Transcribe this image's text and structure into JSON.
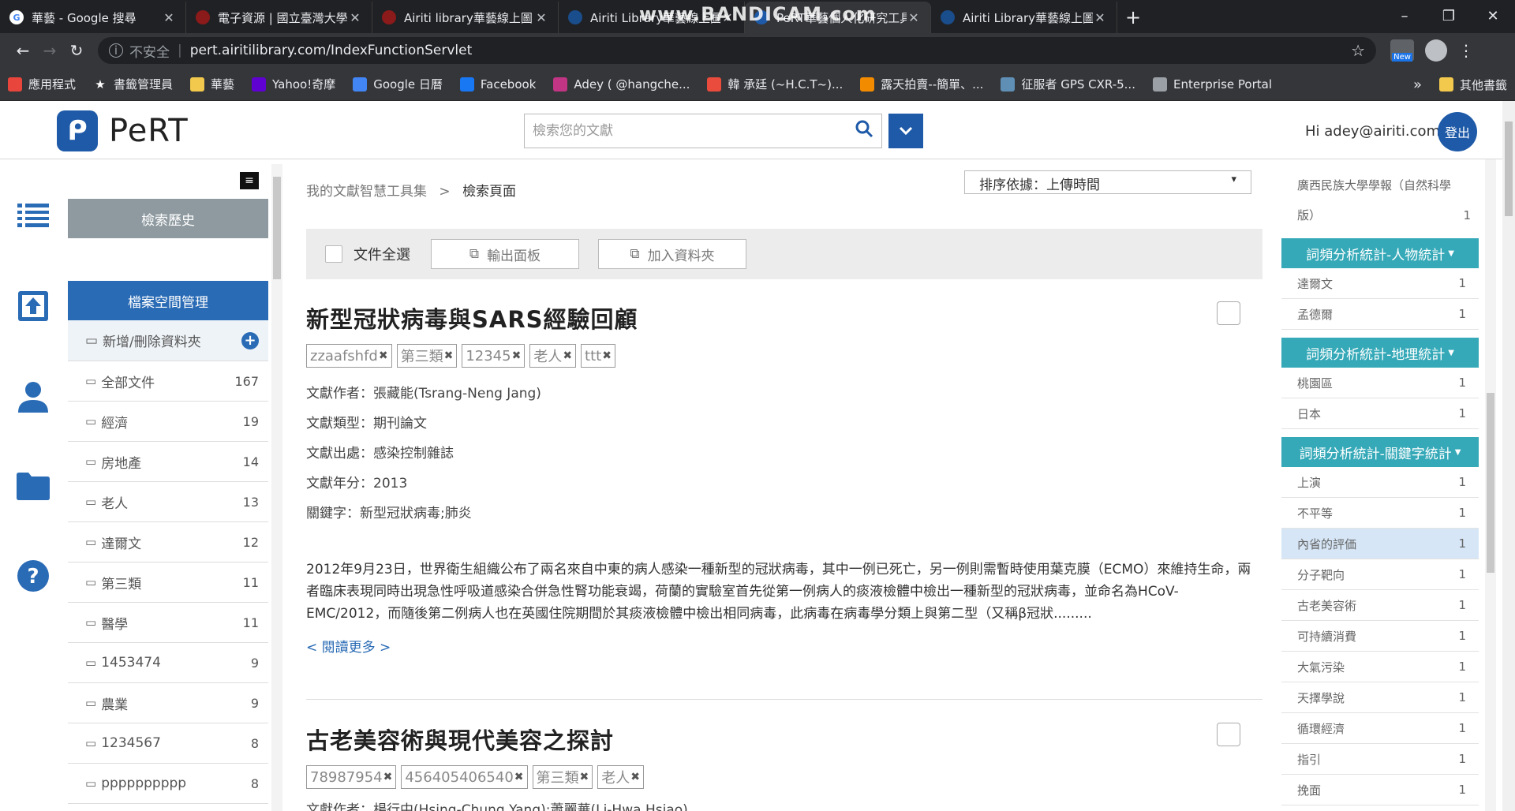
{
  "browser": {
    "watermark": "www.BANDICAM.com",
    "tabs": [
      {
        "title": "華藝 - Google 搜尋",
        "icon": "google-icon",
        "color": "#ffffff",
        "active": false
      },
      {
        "title": "電子資源 | 國立臺灣大學",
        "icon": "ntu-icon",
        "color": "#8b1a1a",
        "active": false
      },
      {
        "title": "Airiti library華藝線上圖",
        "icon": "airiti-icon",
        "color": "#8b1a1a",
        "active": false
      },
      {
        "title": "Airiti Library華藝線上圖",
        "icon": "airiti-library-icon",
        "color": "#1a4d8b",
        "active": false
      },
      {
        "title": "PeRT華藝個人化研究工具",
        "icon": "pert-icon",
        "color": "#1e5aa8",
        "active": true
      },
      {
        "title": "Airiti Library華藝線上圖",
        "icon": "airiti-library-icon",
        "color": "#1a4d8b",
        "active": false
      }
    ],
    "insecure_label": "不安全",
    "url": "pert.airitilibrary.com/IndexFunctionServlet",
    "ext_label": "New",
    "bookmarks": [
      {
        "label": "應用程式",
        "icon": "apps-icon",
        "color": "#e8453c"
      },
      {
        "label": "書籤管理員",
        "icon": "star-icon",
        "color": "#35363a"
      },
      {
        "label": "華藝",
        "icon": "folder-icon",
        "color": "#f2c94c"
      },
      {
        "label": "Yahoo!奇摩",
        "icon": "yahoo-icon",
        "color": "#5f01d1"
      },
      {
        "label": "Google 日曆",
        "icon": "calendar-icon",
        "color": "#4285f4"
      },
      {
        "label": "Facebook",
        "icon": "facebook-icon",
        "color": "#1877f2"
      },
      {
        "label": "Adey ( @hangche...",
        "icon": "instagram-icon",
        "color": "#c13584"
      },
      {
        "label": "韓 承廷 (~H.C.T~)...",
        "icon": "profile-icon",
        "color": "#e94b3c"
      },
      {
        "label": "露天拍賣--簡單、...",
        "icon": "ruten-icon",
        "color": "#f28b00"
      },
      {
        "label": "征服者 GPS CXR-5...",
        "icon": "gps-icon",
        "color": "#5f8fb5"
      },
      {
        "label": "Enterprise Portal",
        "icon": "globe-icon",
        "color": "#9aa0a6"
      }
    ],
    "bookmarks_more": "»",
    "other_bookmarks": "其他書籤"
  },
  "header": {
    "logo_text": "PeRT",
    "search_placeholder": "檢索您的文獻",
    "greeting": "Hi adey@airiti.com",
    "login_label": "登出"
  },
  "left_panel": {
    "history_label": "檢索歷史",
    "space_label": "檔案空間管理",
    "add_folder_label": "新增/刪除資料夾",
    "folders": [
      {
        "name": "全部文件",
        "count": "167"
      },
      {
        "name": "經濟",
        "count": "19"
      },
      {
        "name": "房地產",
        "count": "14"
      },
      {
        "name": "老人",
        "count": "13"
      },
      {
        "name": "達爾文",
        "count": "12"
      },
      {
        "name": "第三類",
        "count": "11"
      },
      {
        "name": "醫學",
        "count": "11"
      },
      {
        "name": "1453474",
        "count": "9"
      },
      {
        "name": "農業",
        "count": "9"
      },
      {
        "name": "1234567",
        "count": "8"
      },
      {
        "name": "pppppppppp",
        "count": "8"
      }
    ]
  },
  "main": {
    "breadcrumb_root": "我的文獻智慧工具集",
    "breadcrumb_sep": ">",
    "breadcrumb_current": "檢索頁面",
    "sort_label": "排序依據：上傳時間",
    "sort_arrow": "▾",
    "select_all_label": "文件全選",
    "export_label": "輸出面板",
    "add_folder_label": "加入資料夾",
    "docs": [
      {
        "title": "新型冠狀病毒與SARS經驗回顧",
        "tags": [
          "zzaafshfd",
          "第三類",
          "12345",
          "老人",
          "ttt"
        ],
        "author": "文獻作者：張藏能(Tsrang-Neng Jang)",
        "type": "文獻類型：期刊論文",
        "source": "文獻出處：感染控制雜誌",
        "year": "文獻年分：2013",
        "keywords": "關鍵字：新型冠狀病毒;肺炎",
        "abstract": "2012年9月23日，世界衛生組織公布了兩名來自中東的病人感染一種新型的冠狀病毒，其中一例已死亡，另一例則需暫時使用葉克膜（ECMO）來維持生命，兩者臨床表現同時出現急性呼吸道感染合併急性腎功能衰竭，荷蘭的實驗室首先從第一例病人的痰液檢體中檢出一種新型的冠狀病毒，並命名為HCoV-EMC/2012，而隨後第二例病人也在英國住院期間於其痰液檢體中檢出相同病毒，此病毒在病毒學分類上與第二型（又稱β冠狀.........",
        "read_more": "< 閱讀更多 >"
      },
      {
        "title": "古老美容術與現代美容之探討",
        "tags": [
          "78987954",
          "456405406540",
          "第三類",
          "老人"
        ],
        "author": "文獻作者：楊行中(Hsing-Chung Yang);蕭麗華(Li-Hwa Hsiao)"
      }
    ]
  },
  "right_panel": {
    "top_items": [
      {
        "name": "廣西民族大學學報（自然科學",
        "count": ""
      },
      {
        "name": "版）",
        "count": "1"
      }
    ],
    "sections": [
      {
        "title": "詞頻分析統計-人物統計",
        "rows": [
          {
            "name": "達爾文",
            "count": "1",
            "highlight": false
          },
          {
            "name": "孟德爾",
            "count": "1",
            "highlight": false
          }
        ]
      },
      {
        "title": "詞頻分析統計-地理統計",
        "rows": [
          {
            "name": "桃園區",
            "count": "1",
            "highlight": false
          },
          {
            "name": "日本",
            "count": "1",
            "highlight": false
          }
        ]
      },
      {
        "title": "詞頻分析統計-關鍵字統計",
        "rows": [
          {
            "name": "上演",
            "count": "1",
            "highlight": false
          },
          {
            "name": "不平等",
            "count": "1",
            "highlight": false
          },
          {
            "name": "內省的評価",
            "count": "1",
            "highlight": true
          },
          {
            "name": "分子靶向",
            "count": "1",
            "highlight": false
          },
          {
            "name": "古老美容術",
            "count": "1",
            "highlight": false
          },
          {
            "name": "可持續消費",
            "count": "1",
            "highlight": false
          },
          {
            "name": "大氣污染",
            "count": "1",
            "highlight": false
          },
          {
            "name": "天擇學說",
            "count": "1",
            "highlight": false
          },
          {
            "name": "循環經濟",
            "count": "1",
            "highlight": false
          },
          {
            "name": "指引",
            "count": "1",
            "highlight": false
          },
          {
            "name": "挽面",
            "count": "1",
            "highlight": false
          }
        ]
      }
    ]
  }
}
